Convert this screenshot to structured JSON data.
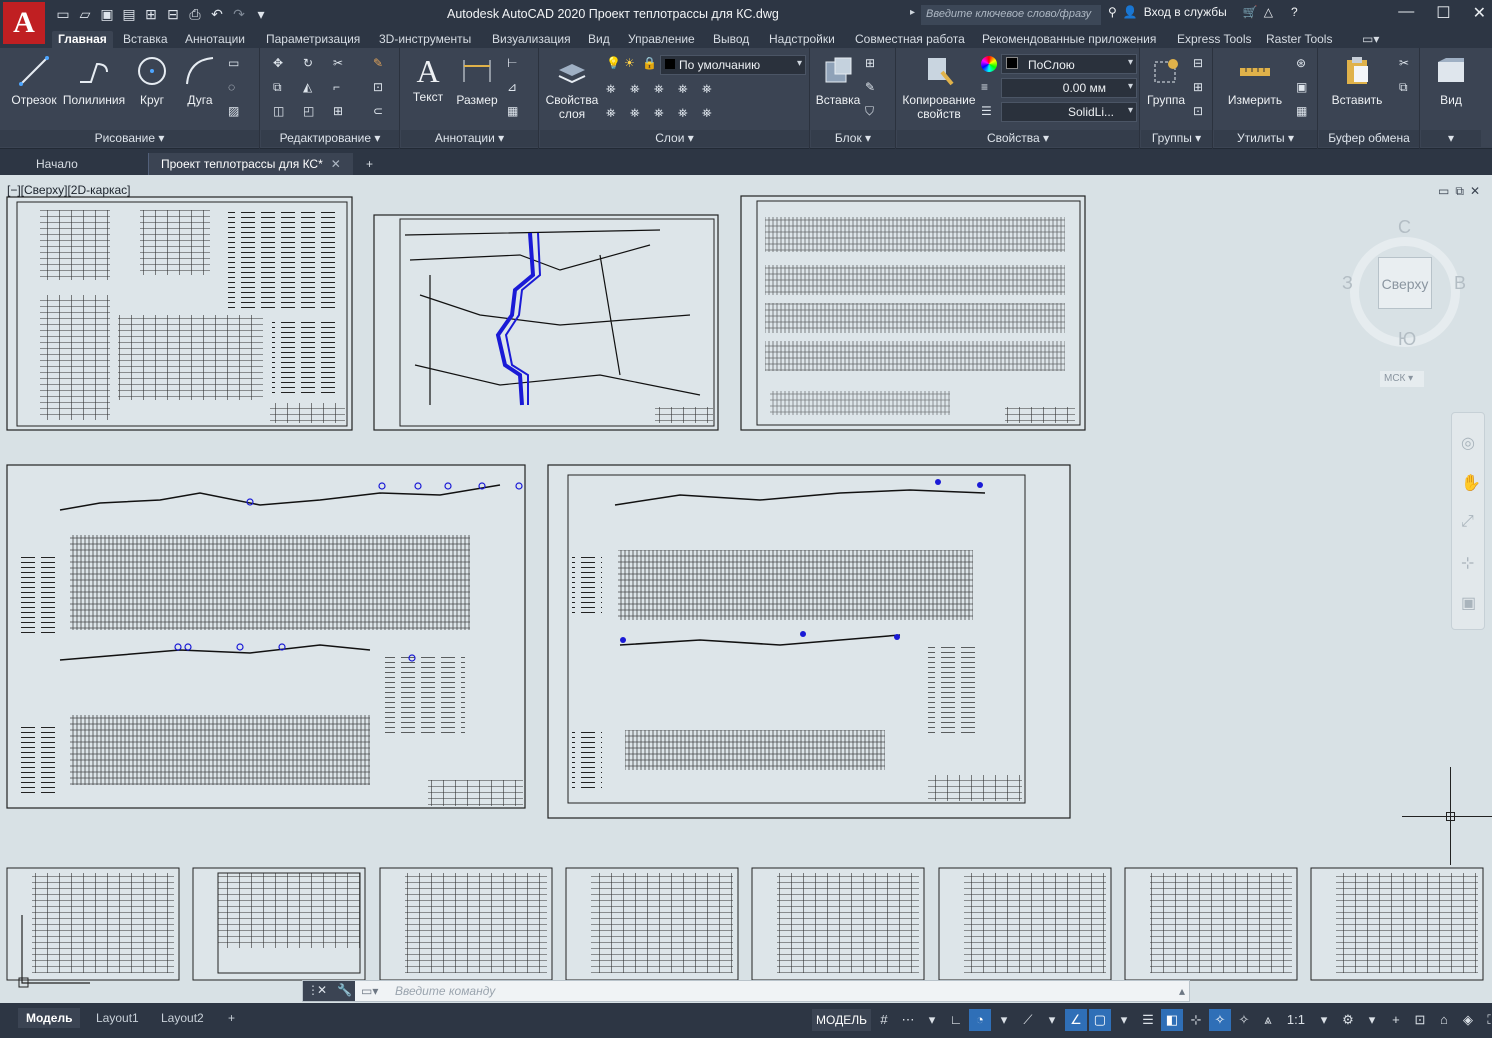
{
  "app": {
    "logo_letter": "A",
    "title": "Autodesk AutoCAD 2020   Проект теплотрассы для КС.dwg",
    "search_placeholder": "Введите ключевое слово/фразу",
    "signin": "Вход в службы"
  },
  "ribbon_tabs": [
    "Главная",
    "Вставка",
    "Аннотации",
    "Параметризация",
    "3D-инструменты",
    "Визуализация",
    "Вид",
    "Управление",
    "Вывод",
    "Надстройки",
    "Совместная работа",
    "Рекомендованные приложения",
    "Express Tools",
    "Raster Tools"
  ],
  "ribbon": {
    "draw": {
      "title": "Рисование",
      "line": "Отрезок",
      "polyline": "Полилиния",
      "circle": "Круг",
      "arc": "Дуга"
    },
    "modify": {
      "title": "Редактирование"
    },
    "annotation": {
      "title": "Аннотации",
      "text": "Текст",
      "dimension": "Размер"
    },
    "layers": {
      "title": "Слои",
      "layer_props_1": "Свойства",
      "layer_props_2": "слоя",
      "current_layer": "По умолчанию"
    },
    "block": {
      "title": "Блок",
      "insert": "Вставка"
    },
    "properties": {
      "title": "Свойства",
      "match_1": "Копирование",
      "match_2": "свойств",
      "color": "ПоСлою",
      "lineweight": "0.00 мм",
      "linetype": "SolidLi..."
    },
    "groups": {
      "title": "Группы",
      "group": "Группа"
    },
    "utilities": {
      "title": "Утилиты",
      "measure": "Измерить"
    },
    "clipboard": {
      "title": "Буфер обмена",
      "paste": "Вставить"
    },
    "view": {
      "title": "Вид"
    }
  },
  "file_tabs": [
    "Начало",
    "Проект теплотрассы для КС*"
  ],
  "viewport": {
    "label": "[−][Сверху][2D-каркас]",
    "viewcube_face": "Сверху",
    "dir_n": "С",
    "dir_s": "Ю",
    "dir_w": "З",
    "dir_e": "В",
    "ucs": "МСК"
  },
  "command": {
    "placeholder": "Введите команду"
  },
  "layout_tabs": [
    "Модель",
    "Layout1",
    "Layout2"
  ],
  "status": {
    "model": "МОДЕЛЬ",
    "scale": "1:1"
  },
  "colors": {
    "title_bg": "#2d3644",
    "ribbon_bg": "#3b4453",
    "canvas_bg": "#d8e1e5",
    "accent": "#2f6fb7",
    "logo_red": "#c01f22"
  }
}
